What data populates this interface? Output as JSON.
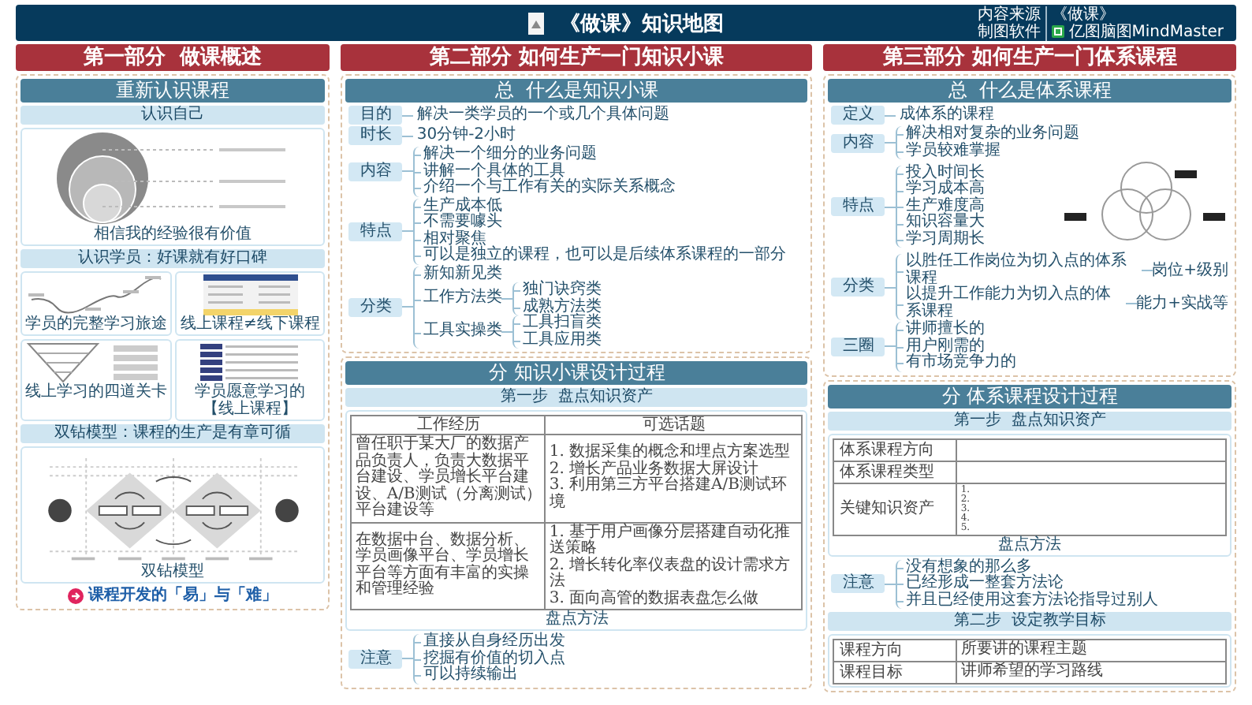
{
  "header": {
    "title": "《做课》知识地图",
    "credits": [
      {
        "label": "内容来源",
        "value": "《做课》"
      },
      {
        "label": "制图软件",
        "value": "亿图脑图MindMaster",
        "logo": true
      }
    ]
  },
  "parts": [
    {
      "title": "第一部分  做课概述",
      "cards": [
        {
          "title": "重新认识课程",
          "blocks": [
            {
              "kind": "subtitle",
              "text": "认识自己"
            },
            {
              "kind": "circles",
              "caption": "相信我的经验很有价值"
            },
            {
              "kind": "subtitle",
              "text": "认识学员：好课就有好口碑"
            },
            {
              "kind": "grid",
              "items": [
                {
                  "kind": "journey",
                  "caption": "学员的完整学习旅途"
                },
                {
                  "kind": "compare",
                  "caption": "线上课程≠线下课程"
                },
                {
                  "kind": "funnel",
                  "caption": "线上学习的四道关卡"
                },
                {
                  "kind": "list",
                  "caption": "学员愿意学习的【线上课程】"
                }
              ]
            },
            {
              "kind": "subtitle",
              "text": "双钻模型：课程的生产是有章可循"
            },
            {
              "kind": "diamond",
              "caption": "双钻模型"
            },
            {
              "kind": "link",
              "text": "课程开发的「易」与「难」"
            }
          ]
        }
      ]
    },
    {
      "title": "第二部分 如何生产一门知识小课",
      "cards": [
        {
          "title": "总  什么是知识小课",
          "blocks": [
            {
              "kind": "tree",
              "rows": [
                {
                  "label": "目的",
                  "items": [
                    {
                      "text": "解决一类学员的一个或几个具体问题"
                    }
                  ]
                },
                {
                  "label": "时长",
                  "items": [
                    {
                      "text": "30分钟-2小时"
                    }
                  ]
                },
                {
                  "label": "内容",
                  "items": [
                    {
                      "text": "解决一个细分的业务问题"
                    },
                    {
                      "text": "讲解一个具体的工具"
                    },
                    {
                      "text": "介绍一个与工作有关的实际关系概念"
                    }
                  ]
                },
                {
                  "label": "特点",
                  "items": [
                    {
                      "text": "生产成本低"
                    },
                    {
                      "text": "不需要噱头"
                    },
                    {
                      "text": "相对聚焦"
                    },
                    {
                      "text": "可以是独立的课程，也可以是后续体系课程的一部分"
                    }
                  ]
                },
                {
                  "label": "分类",
                  "items": [
                    {
                      "text": "新知新见类"
                    },
                    {
                      "text": "工作方法类",
                      "children": [
                        {
                          "text": "独门诀窍类"
                        },
                        {
                          "text": "成熟方法类"
                        }
                      ]
                    },
                    {
                      "text": "工具实操类",
                      "children": [
                        {
                          "text": "工具扫盲类"
                        },
                        {
                          "text": "工具应用类"
                        }
                      ]
                    }
                  ]
                }
              ]
            }
          ]
        },
        {
          "title": "分 知识小课设计过程",
          "blocks": [
            {
              "kind": "subtitle",
              "text": "第一步  盘点知识资产"
            },
            {
              "kind": "table",
              "columns": [
                "工作经历",
                "可选话题"
              ],
              "rows": [
                {
                  "cells": [
                    [
                      "曾任职于某大厂的数据产品负责人，负责大数据平台建设、学员增长平台建设、A/B测试（分离测试）平台建设等"
                    ],
                    [
                      "1. 数据采集的概念和埋点方案选型",
                      "2. 增长产品业务数据大屏设计",
                      "3. 利用第三方平台搭建A/B测试环境"
                    ]
                  ]
                },
                {
                  "cells": [
                    [
                      "在数据中台、数据分析、学员画像平台、学员增长平台等方面有丰富的实操和管理经验"
                    ],
                    [
                      "1. 基于用户画像分层搭建自动化推送策略",
                      "2. 增长转化率仪表盘的设计需求方法",
                      "3. 面向高管的数据表盘怎么做"
                    ]
                  ]
                }
              ],
              "caption": "盘点方法"
            },
            {
              "kind": "tree",
              "rows": [
                {
                  "label": "注意",
                  "items": [
                    {
                      "text": "直接从自身经历出发"
                    },
                    {
                      "text": "挖掘有价值的切入点"
                    },
                    {
                      "text": "可以持续输出"
                    }
                  ]
                }
              ]
            }
          ]
        }
      ]
    },
    {
      "title": "第三部分 如何生产一门体系课程",
      "cards": [
        {
          "title": "总  什么是体系课程",
          "blocks": [
            {
              "kind": "tree",
              "rows": [
                {
                  "label": "定义",
                  "items": [
                    {
                      "text": "成体系的课程"
                    }
                  ]
                },
                {
                  "label": "内容",
                  "items": [
                    {
                      "text": "解决相对复杂的业务问题"
                    },
                    {
                      "text": "学员较难掌握"
                    }
                  ]
                },
                {
                  "label": "特点",
                  "kind": "venn",
                  "items": [
                    {
                      "text": "投入时间长"
                    },
                    {
                      "text": "学习成本高"
                    },
                    {
                      "text": "生产难度高"
                    },
                    {
                      "text": "知识容量大"
                    },
                    {
                      "text": "学习周期长"
                    }
                  ]
                },
                {
                  "label": "分类",
                  "items": [
                    {
                      "text": "以胜任工作岗位为切入点的体系课程",
                      "note": "岗位+级别"
                    },
                    {
                      "text": "以提升工作能力为切入点的体系课程",
                      "note": "能力+实战等"
                    }
                  ]
                },
                {
                  "label": "三圈",
                  "items": [
                    {
                      "text": "讲师擅长的"
                    },
                    {
                      "text": "用户刚需的"
                    },
                    {
                      "text": "有市场竞争力的"
                    }
                  ]
                }
              ]
            }
          ]
        },
        {
          "title": "分 体系课程设计过程",
          "blocks": [
            {
              "kind": "subtitle",
              "text": "第一步  盘点知识资产"
            },
            {
              "kind": "kv-table",
              "rows": [
                {
                  "label": "体系课程方向"
                },
                {
                  "label": "体系课程类型"
                },
                {
                  "label": "关键知识资产",
                  "lines": [
                    "1.",
                    "2.",
                    "3.",
                    "4.",
                    "5."
                  ]
                }
              ],
              "caption": "盘点方法"
            },
            {
              "kind": "tree",
              "rows": [
                {
                  "label": "注意",
                  "items": [
                    {
                      "text": "没有想象的那么多"
                    },
                    {
                      "text": "已经形成一整套方法论"
                    },
                    {
                      "text": "并且已经使用这套方法论指导过别人"
                    }
                  ]
                }
              ]
            },
            {
              "kind": "subtitle",
              "text": "第二步  设定教学目标"
            },
            {
              "kind": "kv-table",
              "rows": [
                {
                  "label": "课程方向",
                  "lines": [
                    "所要讲的课程主题"
                  ]
                },
                {
                  "label": "课程目标",
                  "lines": [
                    "讲师希望的学习路线"
                  ]
                }
              ]
            }
          ]
        }
      ]
    }
  ]
}
